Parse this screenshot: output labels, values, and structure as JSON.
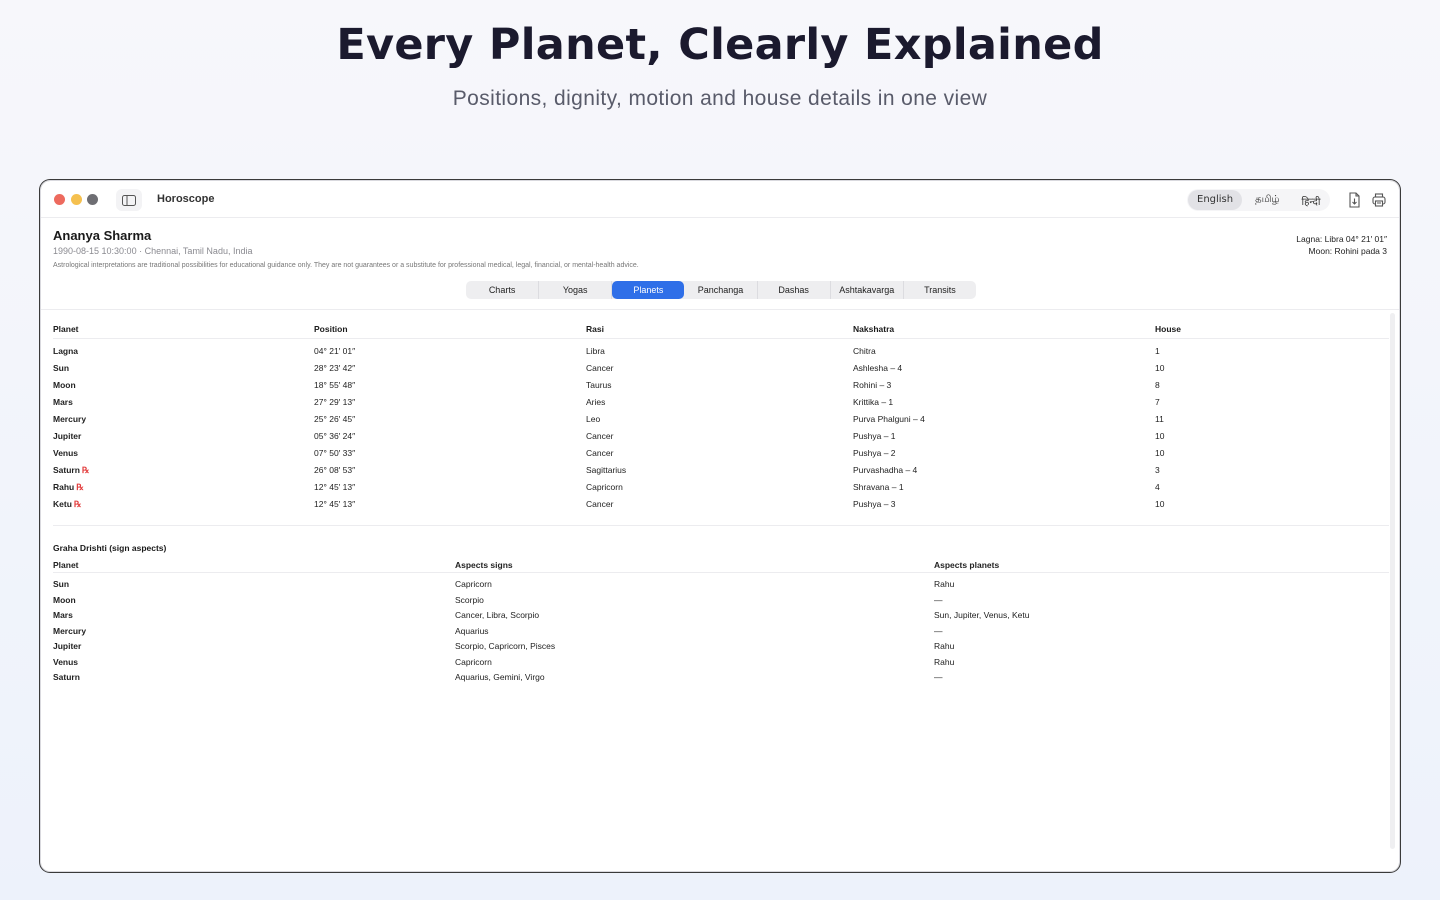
{
  "hero": {
    "title": "Every Planet, Clearly Explained",
    "subtitle": "Positions, dignity, motion and house details in one view"
  },
  "window": {
    "title": "Horoscope",
    "languages": [
      "English",
      "தமிழ்",
      "हिन्दी"
    ],
    "active_language": "English"
  },
  "person": {
    "name": "Ananya Sharma",
    "meta": "1990-08-15  10:30:00  ·  Chennai, Tamil Nadu, India",
    "disclaimer": "Astrological interpretations are traditional possibilities for educational guidance only. They are not guarantees or a substitute for professional medical, legal, financial, or mental-health advice.",
    "lagna": "Lagna: Libra 04° 21′ 01″",
    "moon": "Moon: Rohini pada 3"
  },
  "tabs": [
    "Charts",
    "Yogas",
    "Planets",
    "Panchanga",
    "Dashas",
    "Ashtakavarga",
    "Transits"
  ],
  "active_tab": "Planets",
  "planets_table": {
    "headers": [
      "Planet",
      "Position",
      "Rasi",
      "Nakshatra",
      "House"
    ],
    "retro_symbol": "℞",
    "rows": [
      {
        "planet": "Lagna",
        "retro": false,
        "position": "04° 21′ 01″",
        "rasi": "Libra",
        "nakshatra": "Chitra",
        "house": "1"
      },
      {
        "planet": "Sun",
        "retro": false,
        "position": "28° 23′ 42″",
        "rasi": "Cancer",
        "nakshatra": "Ashlesha – 4",
        "house": "10"
      },
      {
        "planet": "Moon",
        "retro": false,
        "position": "18° 55′ 48″",
        "rasi": "Taurus",
        "nakshatra": "Rohini – 3",
        "house": "8"
      },
      {
        "planet": "Mars",
        "retro": false,
        "position": "27° 29′ 13″",
        "rasi": "Aries",
        "nakshatra": "Krittika – 1",
        "house": "7"
      },
      {
        "planet": "Mercury",
        "retro": false,
        "position": "25° 26′ 45″",
        "rasi": "Leo",
        "nakshatra": "Purva Phalguni – 4",
        "house": "11"
      },
      {
        "planet": "Jupiter",
        "retro": false,
        "position": "05° 36′ 24″",
        "rasi": "Cancer",
        "nakshatra": "Pushya – 1",
        "house": "10"
      },
      {
        "planet": "Venus",
        "retro": false,
        "position": "07° 50′ 33″",
        "rasi": "Cancer",
        "nakshatra": "Pushya – 2",
        "house": "10"
      },
      {
        "planet": "Saturn",
        "retro": true,
        "position": "26° 08′ 53″",
        "rasi": "Sagittarius",
        "nakshatra": "Purvashadha – 4",
        "house": "3"
      },
      {
        "planet": "Rahu",
        "retro": true,
        "position": "12° 45′ 13″",
        "rasi": "Capricorn",
        "nakshatra": "Shravana – 1",
        "house": "4"
      },
      {
        "planet": "Ketu",
        "retro": true,
        "position": "12° 45′ 13″",
        "rasi": "Cancer",
        "nakshatra": "Pushya – 3",
        "house": "10"
      }
    ]
  },
  "aspects": {
    "title": "Graha Drishti (sign aspects)",
    "headers": [
      "Planet",
      "Aspects signs",
      "Aspects planets"
    ],
    "rows": [
      {
        "planet": "Sun",
        "signs": "Capricorn",
        "planets": "Rahu"
      },
      {
        "planet": "Moon",
        "signs": "Scorpio",
        "planets": "—"
      },
      {
        "planet": "Mars",
        "signs": "Cancer, Libra, Scorpio",
        "planets": "Sun, Jupiter, Venus, Ketu"
      },
      {
        "planet": "Mercury",
        "signs": "Aquarius",
        "planets": "—"
      },
      {
        "planet": "Jupiter",
        "signs": "Scorpio, Capricorn, Pisces",
        "planets": "Rahu"
      },
      {
        "planet": "Venus",
        "signs": "Capricorn",
        "planets": "Rahu"
      },
      {
        "planet": "Saturn",
        "signs": "Aquarius, Gemini, Virgo",
        "planets": "—"
      }
    ]
  },
  "colors": {
    "accent": "#2f6fe8",
    "retro": "#e23b3b"
  }
}
